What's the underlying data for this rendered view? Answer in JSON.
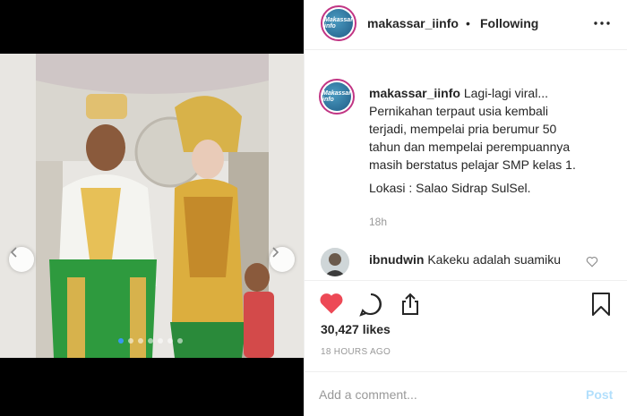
{
  "post": {
    "username": "makassar_iinfo",
    "separator": "•",
    "follow_status": "Following",
    "avatar_text": "Makassar info"
  },
  "caption": {
    "username": "makassar_iinfo",
    "lines": [
      "Lagi-lagi viral...",
      "Pernikahan terpaut usia kembali",
      "terjadi, mempelai pria berumur 50",
      "tahun dan mempelai perempuannya",
      "masih berstatus pelajar SMP kelas 1."
    ],
    "location": "Lokasi : Salao Sidrap SulSel.",
    "time": "18h"
  },
  "comment": {
    "username": "ibnudwin",
    "text": "Kakeku adalah suamiku"
  },
  "likes": "30,427 likes",
  "post_time": "18 HOURS AGO",
  "comment_bar": {
    "placeholder": "Add a comment...",
    "post_label": "Post"
  },
  "carousel": {
    "total": 7,
    "active_index": 0
  },
  "colors": {
    "like_red": "#ed4956",
    "link_blue": "#3897f0",
    "post_disabled": "#b2dffc",
    "muted": "#999999"
  },
  "icons": [
    "more-icon",
    "heart-icon",
    "comment-icon",
    "share-icon",
    "bookmark-icon",
    "chevron-left-icon",
    "chevron-right-icon"
  ]
}
